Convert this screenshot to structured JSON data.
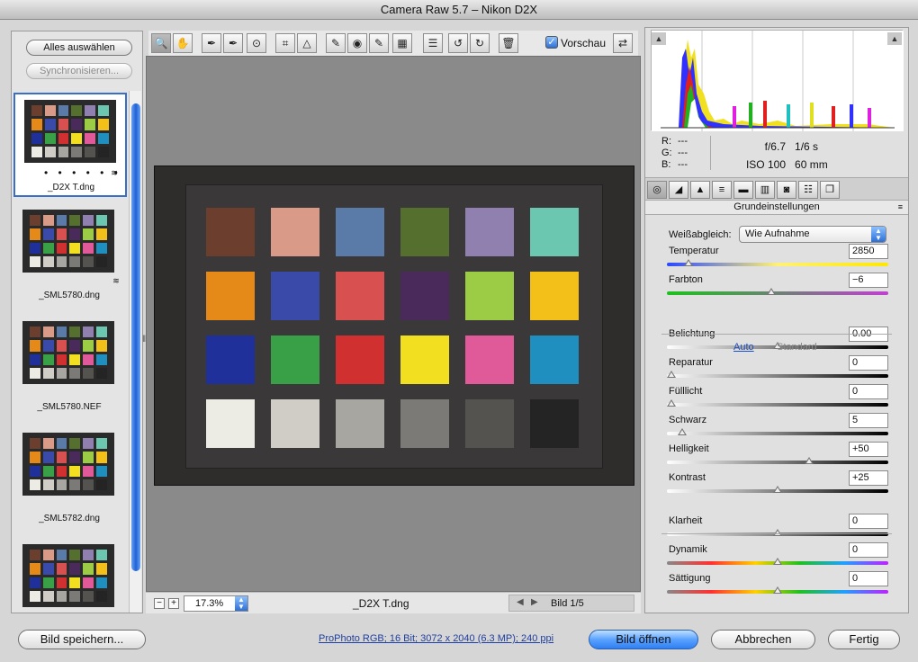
{
  "window": {
    "title": "Camera Raw 5.7 – Nikon D2X"
  },
  "filmstrip": {
    "select_all": "Alles auswählen",
    "synchronize": "Synchronisieren...",
    "dots": "• • • • • •",
    "items": [
      {
        "name": "_D2X T.dng"
      },
      {
        "name": "_SML5780.dng"
      },
      {
        "name": "_SML5780.NEF"
      },
      {
        "name": "_SML5782.dng"
      },
      {
        "name": ""
      }
    ]
  },
  "toolbar": {
    "tools": [
      {
        "icon": "zoom-icon",
        "glyph": "🔍"
      },
      {
        "icon": "hand-icon",
        "glyph": "✋"
      },
      {
        "icon": "white-balance-icon",
        "glyph": "✒"
      },
      {
        "icon": "color-sampler-icon",
        "glyph": "✒"
      },
      {
        "icon": "target-adjustment-icon",
        "glyph": "⊙"
      },
      {
        "icon": "crop-icon",
        "glyph": "⌗"
      },
      {
        "icon": "straighten-icon",
        "glyph": "△"
      },
      {
        "icon": "spot-removal-icon",
        "glyph": "✎"
      },
      {
        "icon": "red-eye-icon",
        "glyph": "◉"
      },
      {
        "icon": "adjustment-brush-icon",
        "glyph": "✎"
      },
      {
        "icon": "graduated-filter-icon",
        "glyph": "▦"
      },
      {
        "icon": "preferences-icon",
        "glyph": "☰"
      },
      {
        "icon": "rotate-ccw-icon",
        "glyph": "↺"
      },
      {
        "icon": "rotate-cw-icon",
        "glyph": "↻"
      },
      {
        "icon": "trash-icon",
        "glyph": "🗑"
      }
    ],
    "preview_label": "Vorschau",
    "preview_checked": true,
    "fullscreen_glyph": "⇄"
  },
  "status": {
    "zoom_minus": "−",
    "zoom_plus": "+",
    "zoom_value": "17.3%",
    "filename": "_D2X T.dng",
    "page": "Bild 1/5"
  },
  "exif": {
    "r_label": "R:",
    "r_value": "---",
    "g_label": "G:",
    "g_value": "---",
    "b_label": "B:",
    "b_value": "---",
    "aperture": "f/6.7",
    "shutter": "1/6 s",
    "iso": "ISO 100",
    "focal": "60 mm"
  },
  "panel": {
    "section_title": "Grundeinstellungen",
    "wb_label": "Weißabgleich:",
    "wb_value": "Wie Aufnahme",
    "auto": "Auto",
    "standard": "Standard",
    "sliders": [
      {
        "id": "temperatur",
        "label": "Temperatur",
        "value": "2850",
        "pos": 0.08
      },
      {
        "id": "farbton",
        "label": "Farbton",
        "value": "−6",
        "pos": 0.47
      },
      {
        "id": "belichtung",
        "label": "Belichtung",
        "value": "0.00",
        "pos": 0.5
      },
      {
        "id": "reparatur",
        "label": "Reparatur",
        "value": "0",
        "pos": 0.0
      },
      {
        "id": "fuelllicht",
        "label": "Fülllicht",
        "value": "0",
        "pos": 0.0
      },
      {
        "id": "schwarz",
        "label": "Schwarz",
        "value": "5",
        "pos": 0.05
      },
      {
        "id": "helligkeit",
        "label": "Helligkeit",
        "value": "+50",
        "pos": 0.65
      },
      {
        "id": "kontrast",
        "label": "Kontrast",
        "value": "+25",
        "pos": 0.5
      },
      {
        "id": "klarheit",
        "label": "Klarheit",
        "value": "0",
        "pos": 0.5
      },
      {
        "id": "dynamik",
        "label": "Dynamik",
        "value": "0",
        "pos": 0.5
      },
      {
        "id": "saettigung",
        "label": "Sättigung",
        "value": "0",
        "pos": 0.5
      }
    ]
  },
  "footer": {
    "save": "Bild speichern...",
    "workflow": "ProPhoto RGB; 16 Bit; 3072 x 2040 (6.3 MP); 240 ppi",
    "open": "Bild öffnen",
    "cancel": "Abbrechen",
    "done": "Fertig"
  },
  "colors": {
    "checker": [
      "#6b3e2e",
      "#d99a88",
      "#5a7aa8",
      "#55702e",
      "#8f80b0",
      "#6cc7b0",
      "#e58a18",
      "#3a4aa8",
      "#d95050",
      "#4a2a5a",
      "#9ccc45",
      "#f2c018",
      "#20309a",
      "#3aa048",
      "#d03030",
      "#f2e020",
      "#e05a9a",
      "#1f8fbf",
      "#ecebe4",
      "#cfcdc6",
      "#a8a6a0",
      "#7c7a76",
      "#55534f",
      "#252424"
    ]
  }
}
